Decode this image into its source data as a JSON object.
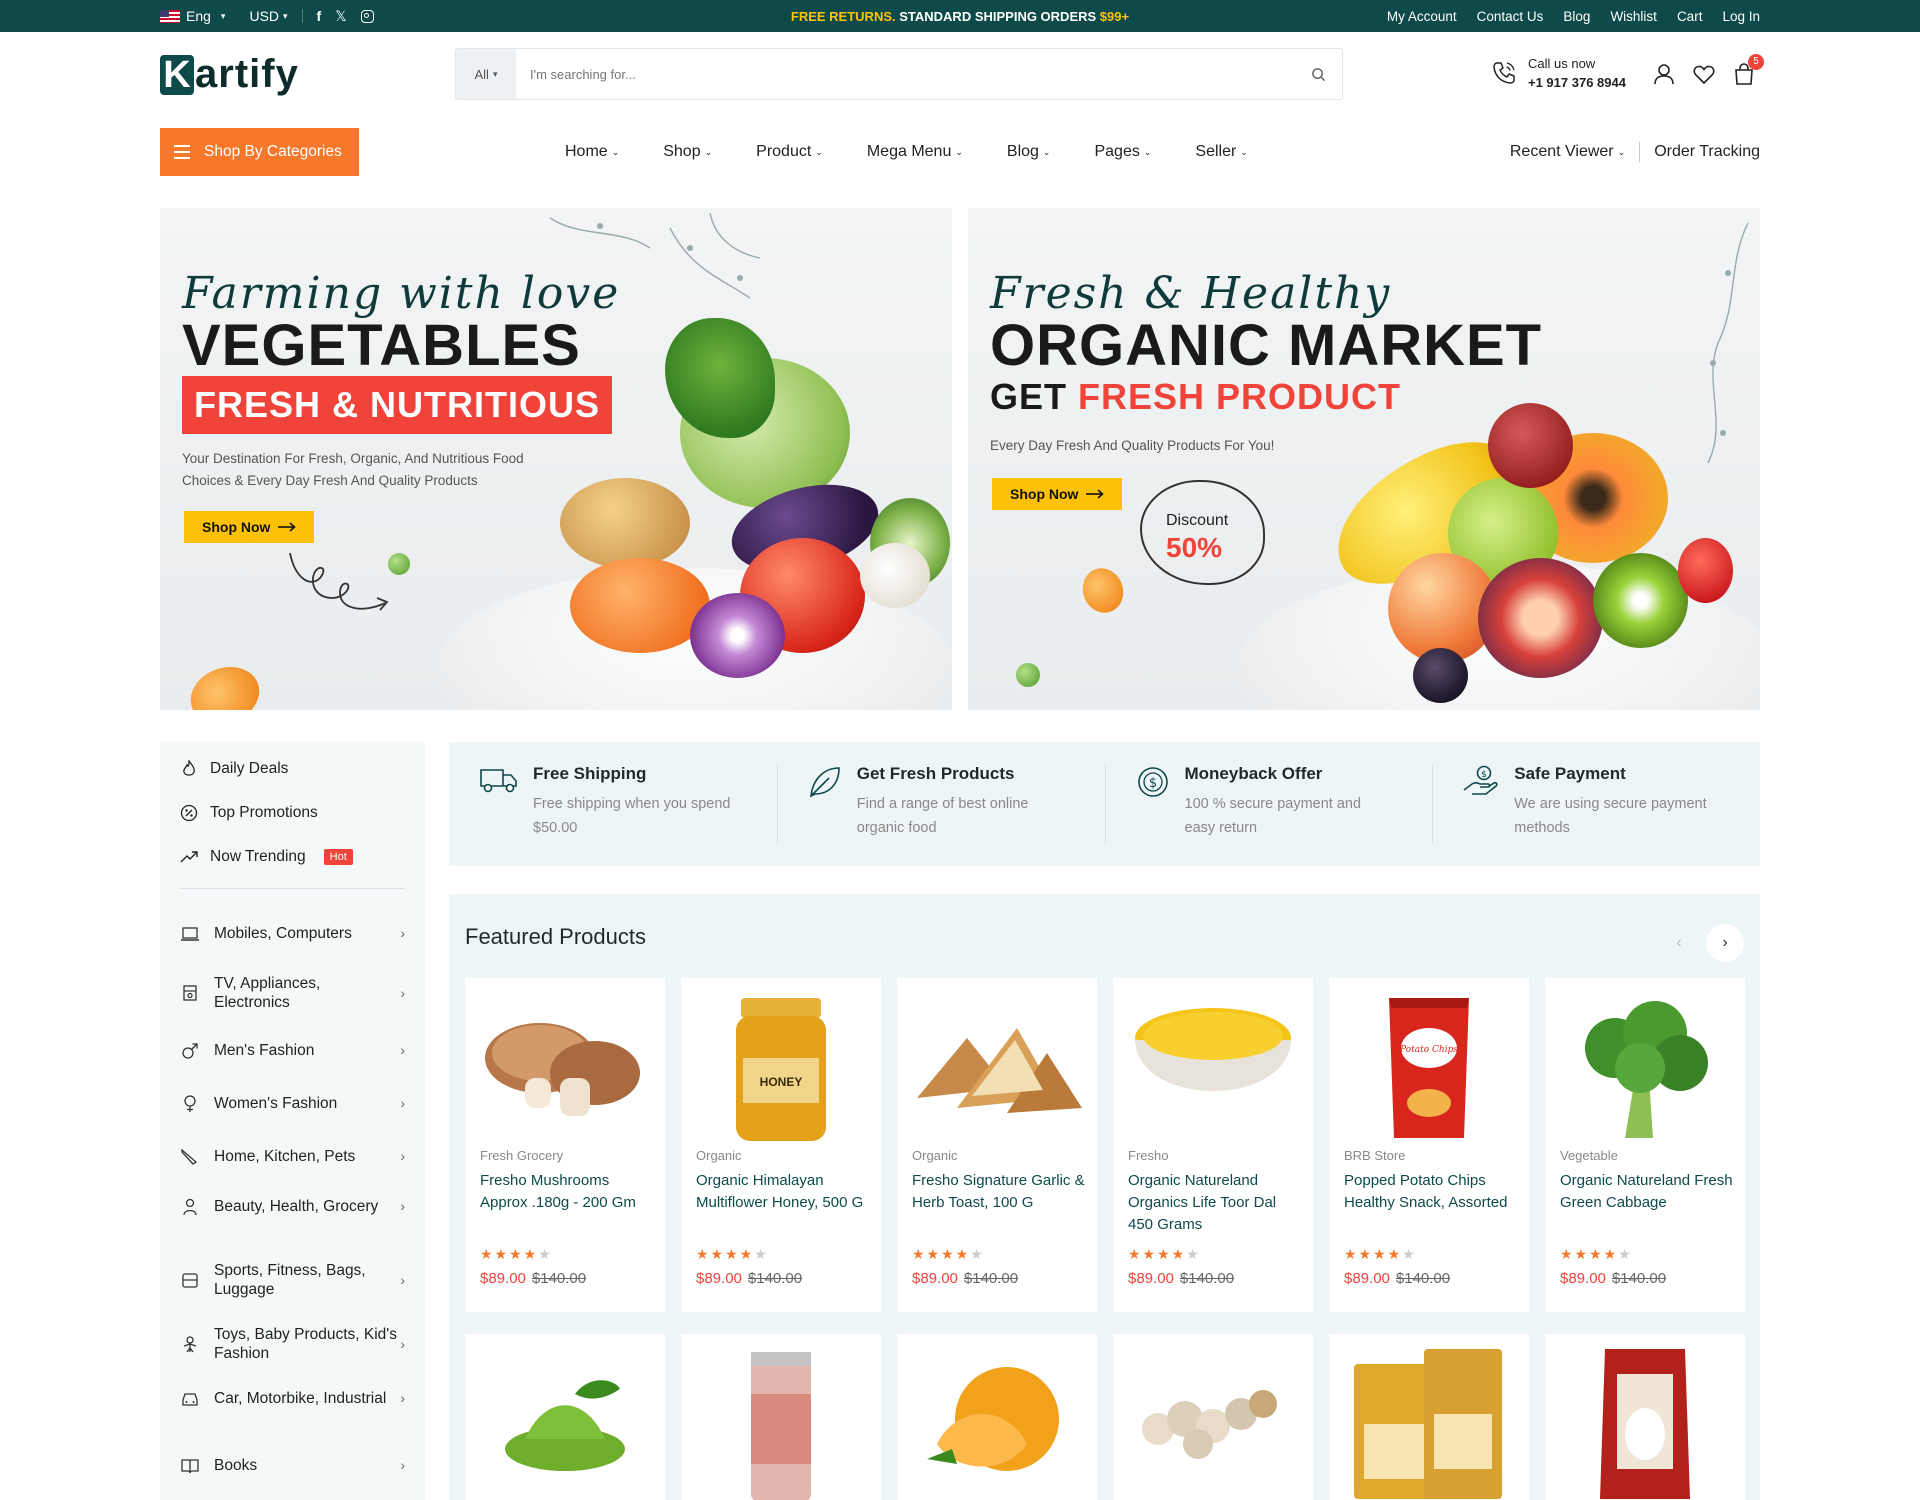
{
  "topbar": {
    "language": "Eng",
    "currency": "USD",
    "promo_highlight": "FREE RETURNS.",
    "promo_text": " STANDARD SHIPPING ORDERS ",
    "promo_amount": "$99+",
    "links": [
      "My Account",
      "Contact Us",
      "Blog",
      "Wishlist",
      "Cart",
      "Log In"
    ]
  },
  "header": {
    "logo_letter": "K",
    "logo_rest": "artify",
    "search_category": "All",
    "search_placeholder": "I'm searching for...",
    "call_label": "Call us now",
    "call_number": "+1 917 376 8944",
    "cart_count": "5"
  },
  "nav": {
    "categories_button": "Shop By Categories",
    "items": [
      "Home",
      "Shop",
      "Product",
      "Mega Menu",
      "Blog",
      "Pages",
      "Seller"
    ],
    "right": [
      "Recent Viewer",
      "Order Tracking"
    ]
  },
  "banners": [
    {
      "script": "Farming with love",
      "heading": "VEGETABLES",
      "highlight": "FRESH & NUTRITIOUS",
      "desc_line1": "Your Destination For Fresh, Organic, And Nutritious Food",
      "desc_line2": "Choices & Every Day Fresh And Quality Products",
      "button": "Shop Now"
    },
    {
      "script": "Fresh & Healthy",
      "heading": "ORGANIC MARKET",
      "sub_prefix": "GET ",
      "sub_highlight": "FRESH PRODUCT",
      "desc": "Every Day Fresh And Quality Products For You!",
      "button": "Shop Now",
      "discount_label": "Discount",
      "discount_value": "50%"
    }
  ],
  "sidebar": {
    "top": [
      {
        "label": "Daily Deals"
      },
      {
        "label": "Top Promotions"
      },
      {
        "label": "Now Trending",
        "badge": "Hot"
      }
    ],
    "categories": [
      {
        "label": "Mobiles, Computers"
      },
      {
        "label": "TV, Appliances, Electronics"
      },
      {
        "label": "Men's Fashion"
      },
      {
        "label": "Women's Fashion"
      },
      {
        "label": "Home, Kitchen, Pets"
      },
      {
        "label": "Beauty, Health, Grocery"
      },
      {
        "label": "Sports, Fitness, Bags, Luggage"
      },
      {
        "label": "Toys, Baby Products, Kid's Fashion"
      },
      {
        "label": "Car, Motorbike, Industrial"
      },
      {
        "label": "Books"
      }
    ]
  },
  "features": [
    {
      "title": "Free Shipping",
      "desc": "Free shipping when you spend $50.00",
      "icon": "truck-icon"
    },
    {
      "title": "Get Fresh Products",
      "desc": "Find a range of best online organic food",
      "icon": "leaf-icon"
    },
    {
      "title": "Moneyback Offer",
      "desc": "100 % secure payment and easy return",
      "icon": "money-icon"
    },
    {
      "title": "Safe Payment",
      "desc": "We are using secure payment methods",
      "icon": "hand-coin-icon"
    }
  ],
  "featured": {
    "title": "Featured Products",
    "prev": "‹",
    "next": "›",
    "products": [
      {
        "category": "Fresh Grocery",
        "name": "Fresho Mushrooms Approx .180g - 200 Gm",
        "rating": 4,
        "price": "$89.00",
        "old_price": "$140.00"
      },
      {
        "category": "Organic",
        "name": "Organic Himalayan Multiflower Honey, 500 G",
        "rating": 4,
        "price": "$89.00",
        "old_price": "$140.00",
        "label": "HONEY"
      },
      {
        "category": "Organic",
        "name": "Fresho Signature Garlic & Herb Toast, 100 G",
        "rating": 4,
        "price": "$89.00",
        "old_price": "$140.00"
      },
      {
        "category": "Fresho",
        "name": "Organic Natureland Organics Life Toor Dal 450 Grams",
        "rating": 4,
        "price": "$89.00",
        "old_price": "$140.00"
      },
      {
        "category": "BRB Store",
        "name": "Popped Potato Chips Healthy Snack, Assorted",
        "rating": 4,
        "price": "$89.00",
        "old_price": "$140.00",
        "label": "Potato Chips"
      },
      {
        "category": "Vegetable",
        "name": "Organic Natureland Fresh Green Cabbage",
        "rating": 4,
        "price": "$89.00",
        "old_price": "$140.00"
      }
    ]
  },
  "colors": {
    "brand_dark": "#0e4a4a",
    "accent_orange": "#f7772b",
    "accent_red": "#f0433a",
    "accent_yellow": "#ffc107"
  }
}
